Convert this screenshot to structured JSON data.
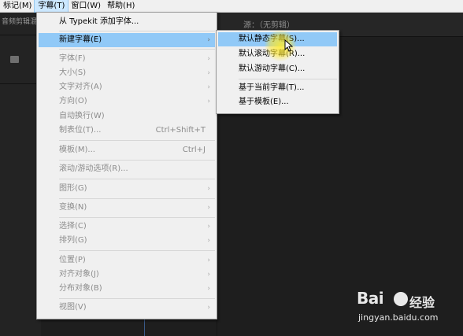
{
  "menubar": {
    "items": [
      {
        "label": "标记(M)"
      },
      {
        "label": "字幕(T)"
      },
      {
        "label": "窗口(W)"
      },
      {
        "label": "帮助(H)"
      }
    ]
  },
  "left_panel": {
    "title": "音频剪辑混"
  },
  "source_panel": {
    "title": "源：（无剪辑）"
  },
  "title_menu": {
    "items": [
      {
        "label": "从 Typekit 添加字体..."
      },
      {
        "label": "新建字幕(E)",
        "arrow": "›"
      },
      {
        "label": "字体(F)",
        "arrow": "›"
      },
      {
        "label": "大小(S)",
        "arrow": "›"
      },
      {
        "label": "文字对齐(A)",
        "arrow": "›"
      },
      {
        "label": "方向(O)",
        "arrow": "›"
      },
      {
        "label": "自动换行(W)"
      },
      {
        "label": "制表位(T)...",
        "shortcut": "Ctrl+Shift+T"
      },
      {
        "label": "模板(M)...",
        "shortcut": "Ctrl+J"
      },
      {
        "label": "滚动/游动选项(R)..."
      },
      {
        "label": "图形(G)",
        "arrow": "›"
      },
      {
        "label": "变换(N)",
        "arrow": "›"
      },
      {
        "label": "选择(C)",
        "arrow": "›"
      },
      {
        "label": "排列(G)",
        "arrow": "›"
      },
      {
        "label": "位置(P)",
        "arrow": "›"
      },
      {
        "label": "对齐对象(J)",
        "arrow": "›"
      },
      {
        "label": "分布对象(B)",
        "arrow": "›"
      },
      {
        "label": "视图(V)",
        "arrow": "›"
      }
    ]
  },
  "new_title_submenu": {
    "items": [
      {
        "label": "默认静态字幕(S)..."
      },
      {
        "label": "默认滚动字幕(R)..."
      },
      {
        "label": "默认游动字幕(C)..."
      },
      {
        "label": "基于当前字幕(T)..."
      },
      {
        "label": "基于模板(E)..."
      }
    ]
  },
  "watermark": {
    "logo": "Bai",
    "logo_suffix": "经验",
    "url": "jingyan.baidu.com"
  },
  "colors": {
    "menu_bg": "#f0f0f0",
    "highlight": "#91c9f7",
    "app_bg": "#1e1e1e"
  }
}
